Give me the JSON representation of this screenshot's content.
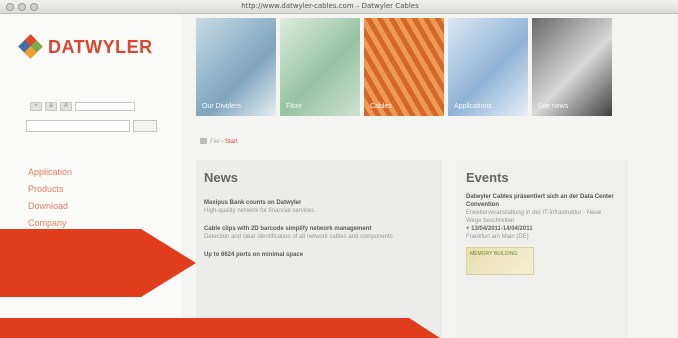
{
  "window": {
    "title": "http://www.datwyler-cables.com – Datwyler Cables"
  },
  "logo": {
    "text": "DATWYLER"
  },
  "toolbar": {
    "a": "+",
    "b": "a",
    "c": "A",
    "field": ""
  },
  "search": {
    "go": ""
  },
  "nav": {
    "items": [
      "Application",
      "Products",
      "Download",
      "Company"
    ]
  },
  "tiles": [
    {
      "label": "Our Dividers"
    },
    {
      "label": "Fibre"
    },
    {
      "label": "Cables"
    },
    {
      "label": "Applications"
    },
    {
      "label": "Site news"
    }
  ],
  "breadcrumb": {
    "path": "Fiel",
    "current": "Start"
  },
  "news": {
    "heading": "News",
    "items": [
      {
        "title": "Maxipus Bank counts on Datwyler",
        "desc": "High-quality network for financial services"
      },
      {
        "title": "Cable clips with 2D barcode simplify network management",
        "desc": "Detection and clear identification of all network cables and components"
      },
      {
        "title": "Up to 6624 ports on minimal space",
        "desc": ""
      }
    ]
  },
  "events": {
    "heading": "Events",
    "title": "Datwyler Cables präsentiert sich an der Data Center Convention",
    "desc": "Erweiterveranstaltung in der IT-Infrastruktur - Neue Wege beschreiten",
    "date": "+ 13/04/2011-14/04/2011",
    "place": "Frankfurt am Main (DE)",
    "badge": "MEMORY BUILDING"
  },
  "colors": {
    "brand": "#d8472e",
    "overlay": "#df3d1c"
  }
}
